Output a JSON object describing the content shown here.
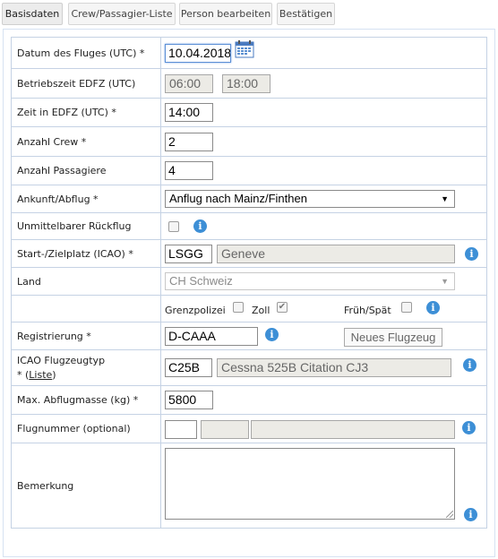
{
  "tabs": [
    {
      "label": "Basisdaten"
    },
    {
      "label": "Crew/Passagier-Liste"
    },
    {
      "label": "Person bearbeiten"
    },
    {
      "label": "Bestätigen"
    }
  ],
  "form": {
    "datum": {
      "label": "Datum des Fluges (UTC) *",
      "value": "10.04.2018"
    },
    "betriebszeit": {
      "label": "Betriebszeit EDFZ (UTC)",
      "from": "06:00",
      "to": "18:00"
    },
    "zeit": {
      "label": "Zeit in EDFZ (UTC) *",
      "value": "14:00"
    },
    "crew": {
      "label": "Anzahl Crew *",
      "value": "2"
    },
    "passagiere": {
      "label": "Anzahl Passagiere",
      "value": "4"
    },
    "ankunft": {
      "label": "Ankunft/Abflug *",
      "selected": "Anflug nach Mainz/Finthen"
    },
    "rueckflug": {
      "label": "Unmittelbarer Rückflug",
      "checked": false
    },
    "startziel": {
      "label": "Start-/Zielplatz (ICAO) *",
      "icao": "LSGG",
      "name": "Geneve"
    },
    "land": {
      "label": "Land",
      "selected": "CH Schweiz"
    },
    "grenze": {
      "grenzpolizei": "Grenzpolizei",
      "zoll": "Zoll",
      "fruehspaet": "Früh/Spät"
    },
    "registrierung": {
      "label": "Registrierung *",
      "value": "D-CAAA",
      "new_button": "Neues Flugzeug"
    },
    "flugzeugtyp": {
      "label_line1": "ICAO Flugzeugtyp",
      "label_prefix": "* (",
      "link": "Liste",
      "label_suffix": ")",
      "code": "C25B",
      "name": "Cessna 525B Citation CJ3"
    },
    "abflugmasse": {
      "label": "Max. Abflugmasse (kg) *",
      "value": "5800"
    },
    "flugnummer": {
      "label": "Flugnummer (optional)",
      "value": ""
    },
    "bemerkung": {
      "label": "Bemerkung",
      "value": ""
    }
  },
  "icons": {
    "info": "i",
    "calendar": "calendar-icon",
    "check": "✔",
    "arrow": "▼"
  }
}
